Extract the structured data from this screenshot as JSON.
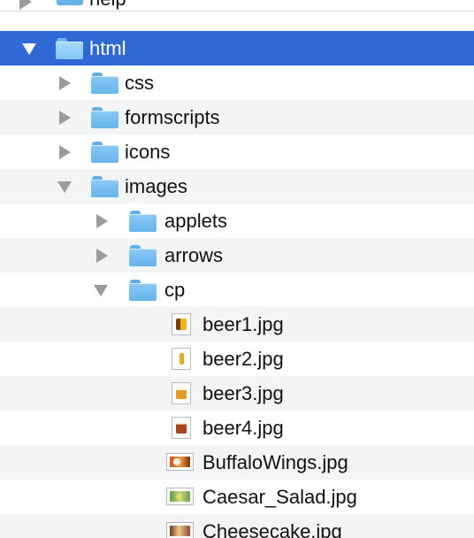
{
  "finder": {
    "partial_top_item": {
      "label": "help"
    },
    "items": [
      {
        "label": "html"
      },
      {
        "label": "css"
      },
      {
        "label": "formscripts"
      },
      {
        "label": "icons"
      },
      {
        "label": "images"
      },
      {
        "label": "applets"
      },
      {
        "label": "arrows"
      },
      {
        "label": "cp"
      },
      {
        "label": "beer1.jpg"
      },
      {
        "label": "beer2.jpg"
      },
      {
        "label": "beer3.jpg"
      },
      {
        "label": "beer4.jpg"
      },
      {
        "label": "BuffaloWings.jpg"
      },
      {
        "label": "Caesar_Salad.jpg"
      },
      {
        "label": "Cheesecake.jpg"
      }
    ]
  },
  "icons": {
    "disclosure_collapsed": "disclosure-collapsed-icon",
    "disclosure_expanded": "disclosure-expanded-icon",
    "folder": "folder-icon",
    "image_file": "image-file-icon"
  },
  "colors": {
    "selected_row": "#2e69d6",
    "alternate_row": "#f3f4f5",
    "folder_blue": "#65b3ec",
    "disclosure_gray": "#9b9b9b",
    "text": "#111111"
  }
}
